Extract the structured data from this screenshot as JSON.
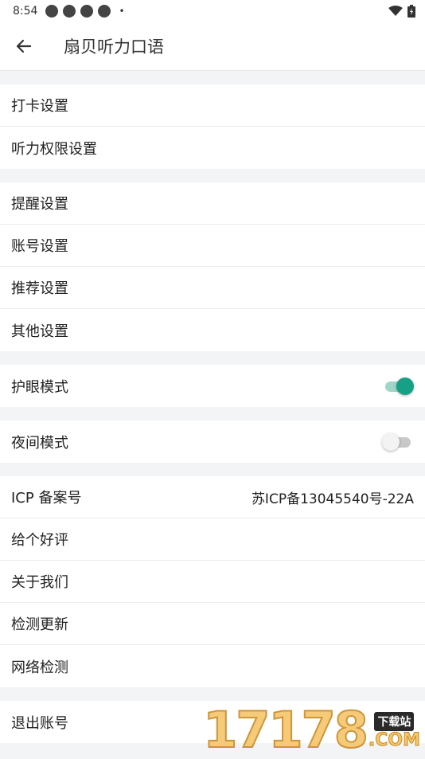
{
  "status_bar": {
    "time": "8:54",
    "notification_icons": [
      "app-notification-icon",
      "app-notification-icon",
      "app-notification-icon",
      "app-notification-icon"
    ],
    "dot": "•"
  },
  "app_bar": {
    "title": "扇贝听力口语"
  },
  "groups": [
    {
      "items": [
        "打卡设置",
        "听力权限设置"
      ]
    },
    {
      "items": [
        "提醒设置",
        "账号设置",
        "推荐设置",
        "其他设置"
      ]
    }
  ],
  "toggles": {
    "eye_care": {
      "label": "护眼模式",
      "on": true
    },
    "night_mode": {
      "label": "夜间模式",
      "on": false
    }
  },
  "info_group": {
    "icp_label": "ICP 备案号",
    "icp_value": "苏ICP备13045540号-22A",
    "items": [
      "给个好评",
      "关于我们",
      "检测更新",
      "网络检测"
    ]
  },
  "logout": {
    "label": "退出账号"
  },
  "watermark": {
    "digits": "17178",
    "tag": "下载站",
    "domain": ".COM"
  },
  "colors": {
    "accent": "#16a085",
    "background": "#f2f4f5"
  }
}
